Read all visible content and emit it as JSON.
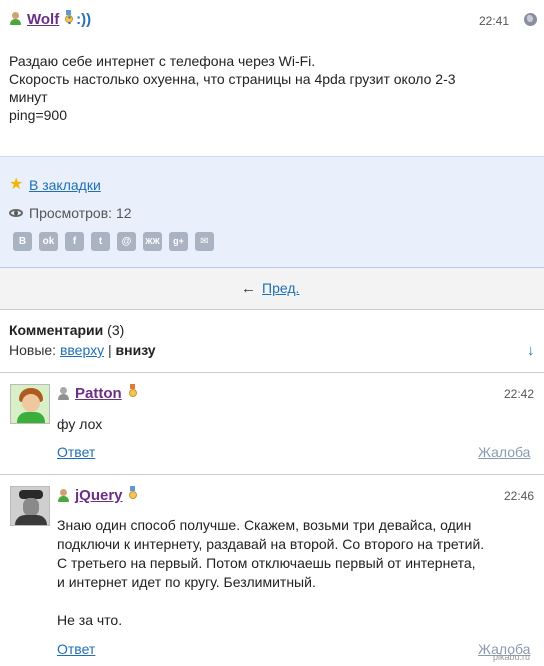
{
  "post": {
    "author": "Wolf",
    "status": ": :))",
    "time": "22:41",
    "lines": [
      "Раздаю себе интернет с телефона через Wi-Fi.",
      "Скорость настолько охуенна, что страницы на 4pda грузит около 2-3",
      "минут",
      "ping=900"
    ]
  },
  "footer": {
    "bookmark_label": "В закладки",
    "views_label": "Просмотров: 12",
    "share_buttons": [
      "В",
      "ok",
      "f",
      "t",
      "@",
      "ЖЖ",
      "g+",
      "✉"
    ]
  },
  "pager": {
    "arrow": "←",
    "prev_label": "Пред."
  },
  "comments_section": {
    "title": "Комментарии",
    "count": "(3)",
    "new_label": "Новые:",
    "sort_up": "вверху",
    "separator": "|",
    "sort_down": "внизу",
    "down_arrow": "↓"
  },
  "comments": [
    {
      "author": "Patton",
      "time": "22:42",
      "lines": [
        "фу лох"
      ],
      "reply_label": "Ответ",
      "report_label": "Жалоба"
    },
    {
      "author": "jQuery",
      "time": "22:46",
      "lines": [
        "Знаю один способ получше. Скажем, возьми три девайса, один",
        "подключи к интернету, раздавай на второй. Со второго на третий.",
        "С третьего на первый. Потом отключаешь первый от интернета,",
        "и интернет идет по кругу. Безлимитный.",
        "",
        "Не за что."
      ],
      "reply_label": "Ответ",
      "report_label": "Жалоба"
    }
  ],
  "watermark": "pikabu.ru",
  "colors": {
    "nick": "#6b2f86",
    "link": "#1e6fb5",
    "footer_bg": "#e9f0fc",
    "pager_bg": "#f3f3f3"
  }
}
